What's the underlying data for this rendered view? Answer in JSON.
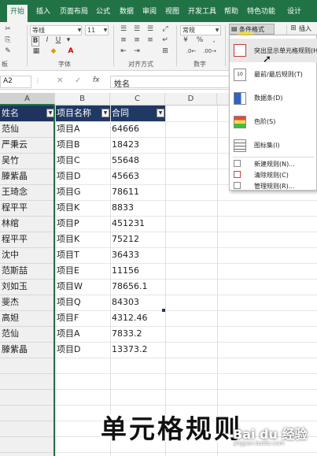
{
  "ribbon_tabs": [
    "开始",
    "插入",
    "页面布局",
    "公式",
    "数据",
    "审阅",
    "视图",
    "开发工具",
    "帮助",
    "特色功能",
    "设计"
  ],
  "font": {
    "name": "等线",
    "size": "11"
  },
  "number_format": "常规",
  "groups": {
    "font": "字体",
    "align": "对齐方式",
    "number": "数字"
  },
  "cond_format_label": "条件格式",
  "insert_label": "插入",
  "clipboard_short": "板",
  "percent_symbol": "%",
  "name_box": "A2",
  "fx_label": "fx",
  "formula": "姓名",
  "columns": [
    "A",
    "B",
    "C",
    "D"
  ],
  "table": {
    "headers": [
      "姓名",
      "项目名称",
      "合同"
    ],
    "rows": [
      [
        "范仙",
        "项目A",
        "64666"
      ],
      [
        "严秉云",
        "项目B",
        "18423"
      ],
      [
        "吴竹",
        "项目C",
        "55648"
      ],
      [
        "滕紫晶",
        "项目D",
        "45663"
      ],
      [
        "王琦念",
        "项目G",
        "78611"
      ],
      [
        "程平平",
        "项目K",
        "8833"
      ],
      [
        "林绾",
        "项目P",
        "451231"
      ],
      [
        "程平平",
        "项目K",
        "75212"
      ],
      [
        "沈中",
        "项目T",
        "36433"
      ],
      [
        "范斯喆",
        "项目E",
        "11156"
      ],
      [
        "刘如玉",
        "项目W",
        "78656.1"
      ],
      [
        "斐杰",
        "项目Q",
        "84303"
      ],
      [
        "高妲",
        "项目F",
        "4312.46"
      ],
      [
        "范仙",
        "项目A",
        "7833.2"
      ],
      [
        "滕紫晶",
        "项目D",
        "13373.2"
      ]
    ]
  },
  "menu": {
    "items": [
      "突出显示单元格规则(H)",
      "最前/最后规则(T)",
      "数据条(D)",
      "色阶(S)",
      "图标集(I)"
    ],
    "sub_items": [
      "新建规则(N)...",
      "清除规则(C)",
      "管理规则(R)..."
    ]
  },
  "caption": "单元格规则",
  "watermark": "Bai du 经验",
  "watermark_url": "jingyan.baidu.com",
  "colors": {
    "accent": "#217346",
    "header_fill": "#203864",
    "highlight": "#ffe600"
  }
}
